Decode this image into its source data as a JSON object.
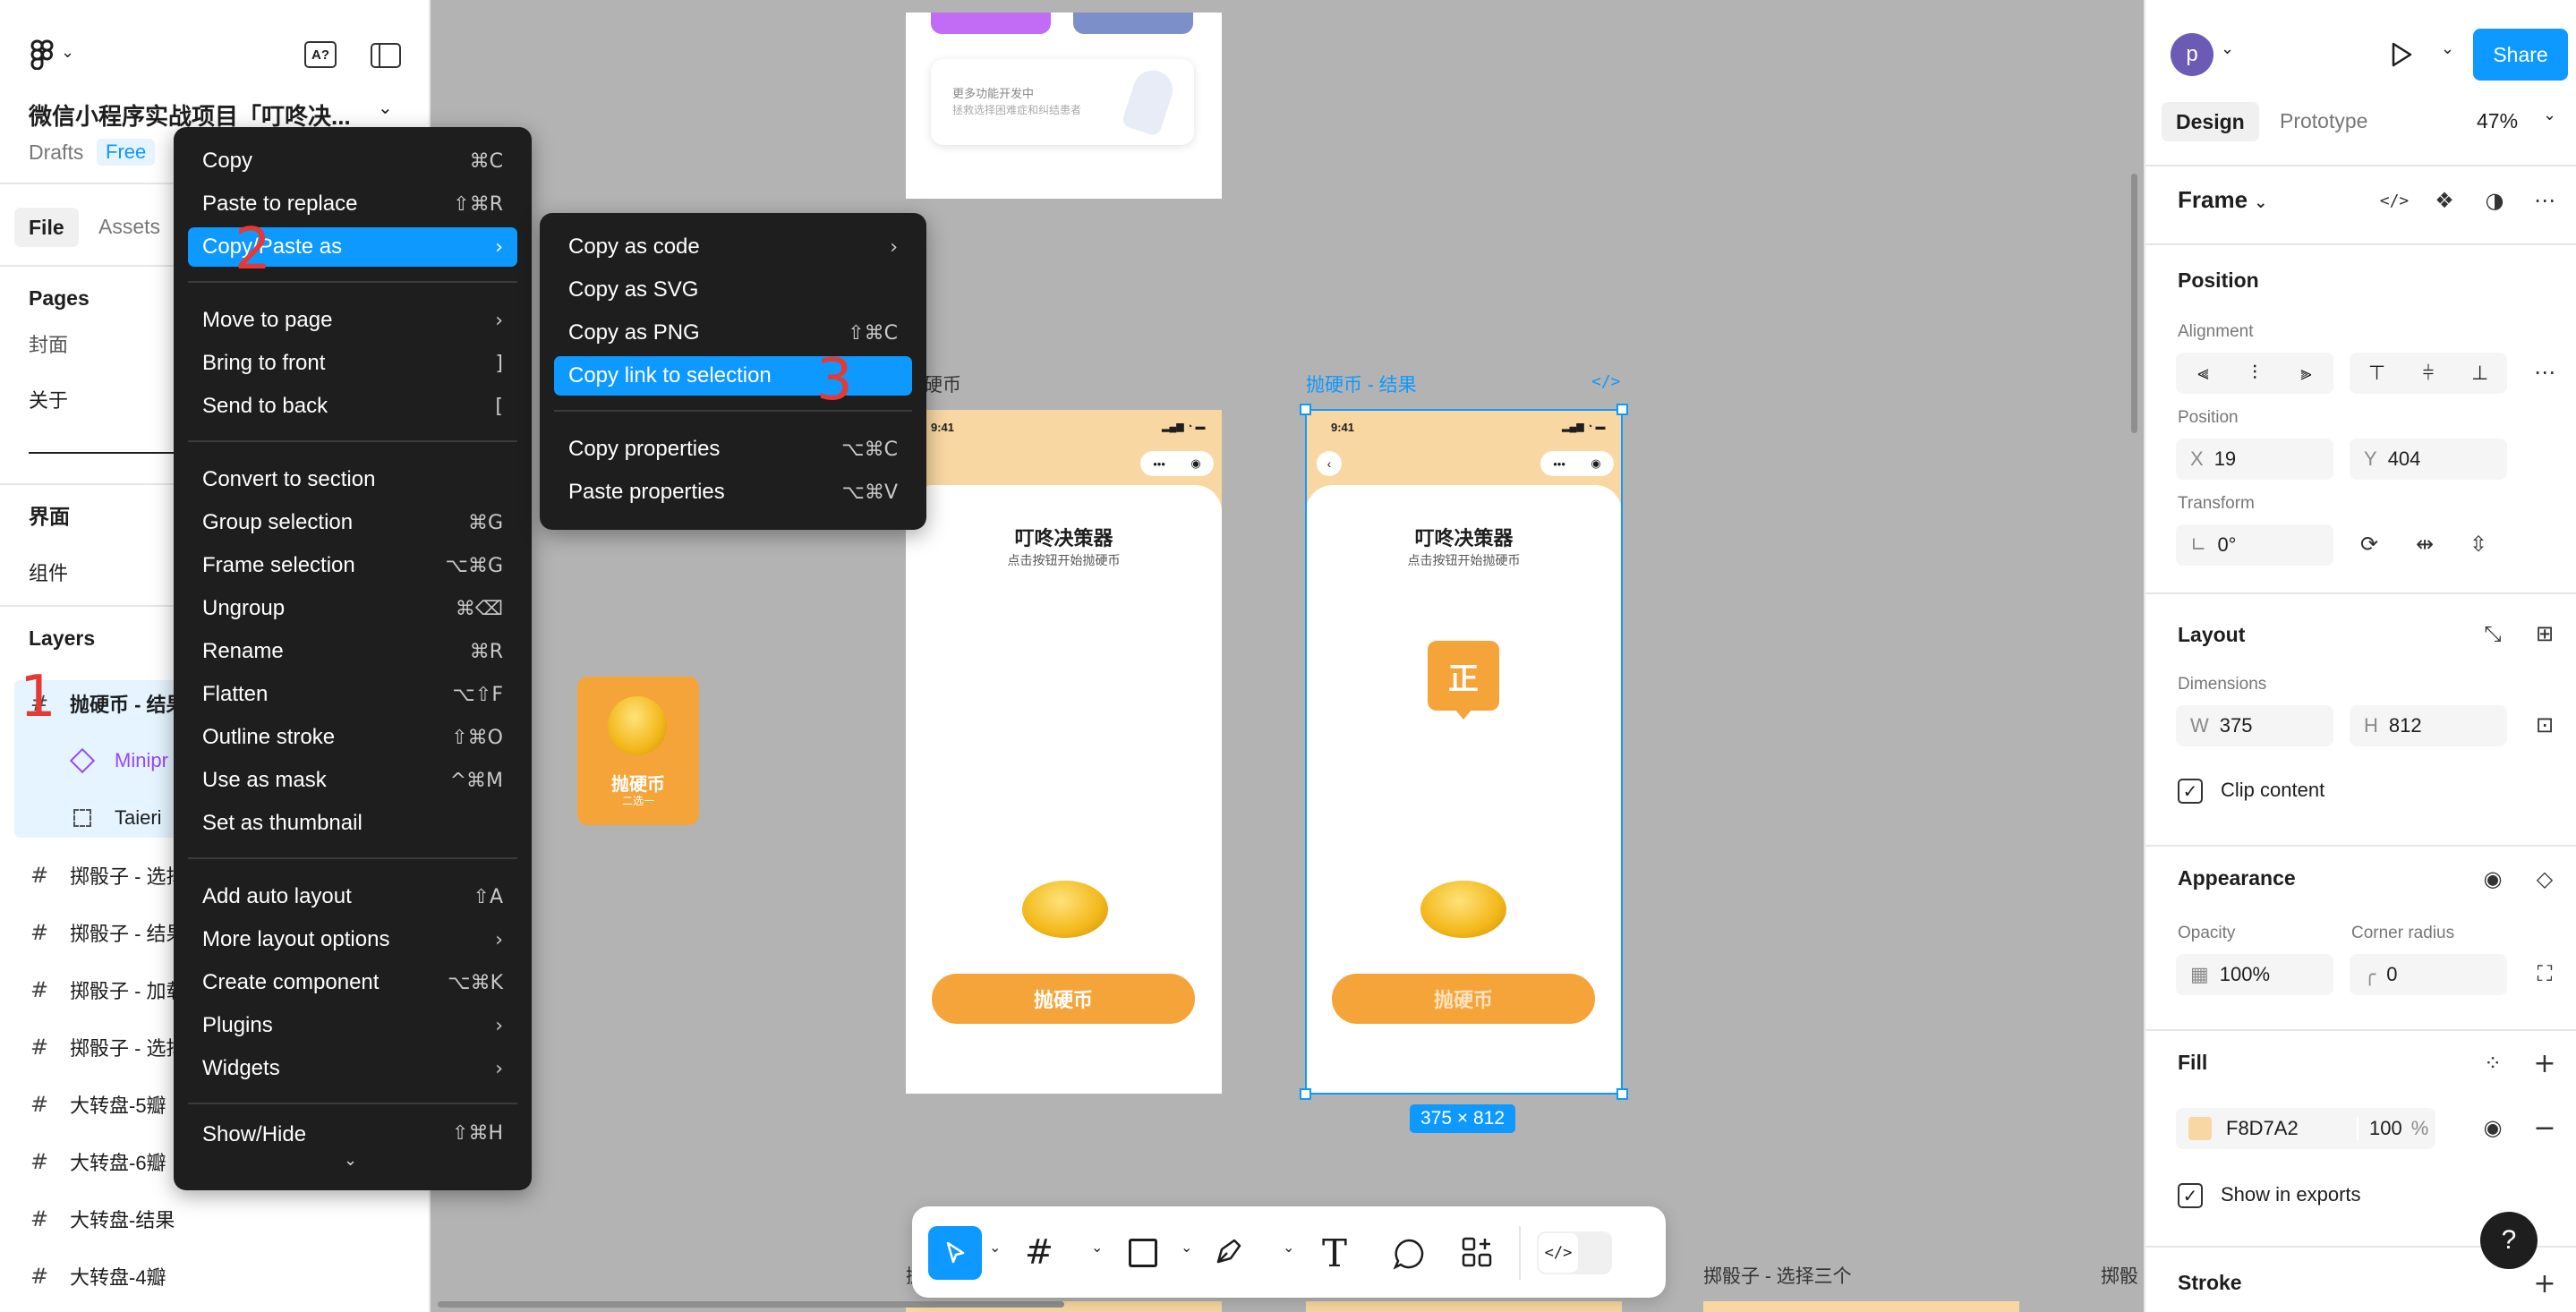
{
  "left_panel": {
    "file_title": "微信小程序实战项目「叮咚决...",
    "drafts_label": "Drafts",
    "free_badge": "Free",
    "tabs": [
      "File",
      "Assets"
    ],
    "pages_header": "Pages",
    "pages": [
      "封面",
      "关于"
    ],
    "sections": [
      "界面",
      "组件"
    ],
    "layers_header": "Layers",
    "layers": [
      {
        "name": "抛硬币 - 结果",
        "type": "frame"
      },
      {
        "name": "Minipr",
        "type": "component"
      },
      {
        "name": "Taieri",
        "type": "text"
      },
      {
        "name": "掷骰子 - 选择",
        "type": "frame"
      },
      {
        "name": "掷骰子 - 结果",
        "type": "frame"
      },
      {
        "name": "掷骰子 - 加载",
        "type": "frame"
      },
      {
        "name": "掷骰子 - 选择",
        "type": "frame"
      },
      {
        "name": "大转盘-5瓣",
        "type": "frame"
      },
      {
        "name": "大转盘-6瓣",
        "type": "frame"
      },
      {
        "name": "大转盘-结果",
        "type": "frame"
      },
      {
        "name": "大转盘-4瓣",
        "type": "frame"
      }
    ]
  },
  "context_menu": {
    "items": [
      {
        "label": "Copy",
        "shortcut": "⌘C"
      },
      {
        "label": "Paste to replace",
        "shortcut": "⇧⌘R"
      },
      {
        "label": "Copy/Paste as",
        "shortcut": "›"
      },
      {
        "label": "Move to page",
        "shortcut": "›"
      },
      {
        "label": "Bring to front",
        "shortcut": "]"
      },
      {
        "label": "Send to back",
        "shortcut": "["
      },
      {
        "label": "Convert to section",
        "shortcut": ""
      },
      {
        "label": "Group selection",
        "shortcut": "⌘G"
      },
      {
        "label": "Frame selection",
        "shortcut": "⌥⌘G"
      },
      {
        "label": "Ungroup",
        "shortcut": "⌘⌫"
      },
      {
        "label": "Rename",
        "shortcut": "⌘R"
      },
      {
        "label": "Flatten",
        "shortcut": "⌥⇧F"
      },
      {
        "label": "Outline stroke",
        "shortcut": "⇧⌘O"
      },
      {
        "label": "Use as mask",
        "shortcut": "^⌘M"
      },
      {
        "label": "Set as thumbnail",
        "shortcut": ""
      },
      {
        "label": "Add auto layout",
        "shortcut": "⇧A"
      },
      {
        "label": "More layout options",
        "shortcut": "›"
      },
      {
        "label": "Create component",
        "shortcut": "⌥⌘K"
      },
      {
        "label": "Plugins",
        "shortcut": "›"
      },
      {
        "label": "Widgets",
        "shortcut": "›"
      },
      {
        "label": "Show/Hide",
        "shortcut": "⇧⌘H"
      }
    ]
  },
  "submenu": {
    "items": [
      {
        "label": "Copy as code",
        "shortcut": "›"
      },
      {
        "label": "Copy as SVG",
        "shortcut": ""
      },
      {
        "label": "Copy as PNG",
        "shortcut": "⇧⌘C"
      },
      {
        "label": "Copy link to selection",
        "shortcut": ""
      },
      {
        "label": "Copy properties",
        "shortcut": "⌥⌘C"
      },
      {
        "label": "Paste properties",
        "shortcut": "⌥⌘V"
      }
    ]
  },
  "annotations": {
    "step1": "1",
    "step2": "2",
    "step3": "3"
  },
  "canvas": {
    "top_card_text1": "更多功能开发中",
    "top_card_text2": "拯救选择困难症和纠结患者",
    "frame_left_label": "硬币",
    "frame_right_label": "抛硬币 - 结果",
    "status_time": "9:41",
    "app_title": "叮咚决策器",
    "app_subtitle": "点击按钮开始抛硬币",
    "result_text": "正",
    "button_label": "抛硬币",
    "tile_title": "抛硬币",
    "tile_sub": "二选一",
    "dimension_badge": "375 × 812",
    "bottom_label_1": "掷骰子 - 选择三个",
    "bottom_label_2": "掷骰",
    "bottom_label_left": "抛"
  },
  "right_panel": {
    "avatar_letter": "p",
    "share_label": "Share",
    "tabs": [
      "Design",
      "Prototype"
    ],
    "zoom": "47%",
    "frame_label": "Frame",
    "position_header": "Position",
    "alignment_label": "Alignment",
    "position_label": "Position",
    "x_label": "X",
    "x_value": "19",
    "y_label": "Y",
    "y_value": "404",
    "transform_label": "Transform",
    "rotation_value": "0°",
    "layout_header": "Layout",
    "dimensions_label": "Dimensions",
    "w_label": "W",
    "w_value": "375",
    "h_label": "H",
    "h_value": "812",
    "clip_content_label": "Clip content",
    "appearance_header": "Appearance",
    "opacity_label": "Opacity",
    "opacity_value": "100%",
    "corner_radius_label": "Corner radius",
    "corner_radius_value": "0",
    "fill_header": "Fill",
    "fill_hex": "F8D7A2",
    "fill_opacity": "100",
    "percent_sign": "%",
    "fill_color": "#F8D7A2",
    "show_in_exports_label": "Show in exports",
    "stroke_header": "Stroke",
    "help_label": "?"
  },
  "colors": {
    "accent": "#0d99ff",
    "annotation": "#e53935",
    "brand_orange": "#f5a43a"
  }
}
